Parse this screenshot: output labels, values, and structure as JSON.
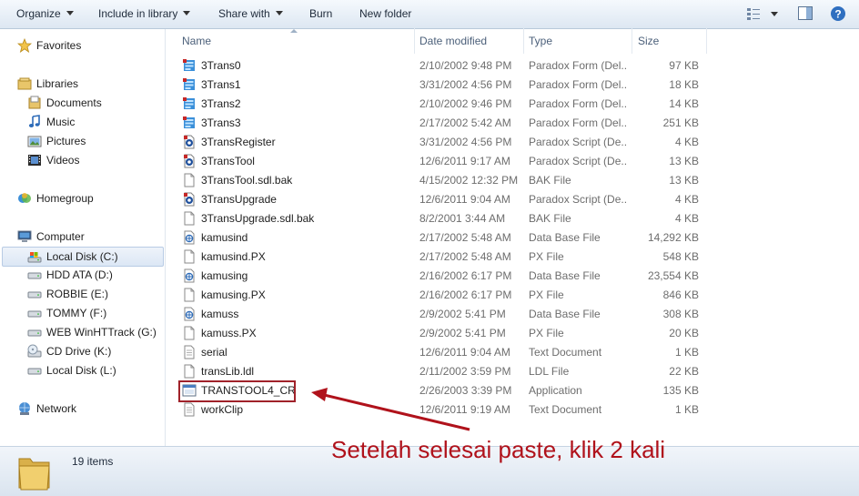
{
  "toolbar": {
    "organize": "Organize",
    "include_in_library": "Include in library",
    "share_with": "Share with",
    "burn": "Burn",
    "new_folder": "New folder"
  },
  "nav": {
    "favorites": "Favorites",
    "libraries": "Libraries",
    "documents": "Documents",
    "music": "Music",
    "pictures": "Pictures",
    "videos": "Videos",
    "homegroup": "Homegroup",
    "computer": "Computer",
    "drives": [
      "Local Disk (C:)",
      "HDD ATA (D:)",
      "ROBBIE (E:)",
      "TOMMY (F:)",
      "WEB WinHTTrack (G:)",
      "CD Drive (K:)",
      "Local Disk (L:)"
    ],
    "network": "Network"
  },
  "columns": {
    "name": "Name",
    "date": "Date modified",
    "type": "Type",
    "size": "Size"
  },
  "files": [
    {
      "name": "3Trans0",
      "date": "2/10/2002 9:48 PM",
      "type": "Paradox Form (Del...",
      "size": "97 KB",
      "icon": "form"
    },
    {
      "name": "3Trans1",
      "date": "3/31/2002 4:56 PM",
      "type": "Paradox Form (Del...",
      "size": "18 KB",
      "icon": "form"
    },
    {
      "name": "3Trans2",
      "date": "2/10/2002 9:46 PM",
      "type": "Paradox Form (Del...",
      "size": "14 KB",
      "icon": "form"
    },
    {
      "name": "3Trans3",
      "date": "2/17/2002 5:42 AM",
      "type": "Paradox Form (Del...",
      "size": "251 KB",
      "icon": "form"
    },
    {
      "name": "3TransRegister",
      "date": "3/31/2002 4:56 PM",
      "type": "Paradox Script (De...",
      "size": "4 KB",
      "icon": "script"
    },
    {
      "name": "3TransTool",
      "date": "12/6/2011 9:17 AM",
      "type": "Paradox Script (De...",
      "size": "13 KB",
      "icon": "script"
    },
    {
      "name": "3TransTool.sdl.bak",
      "date": "4/15/2002 12:32 PM",
      "type": "BAK File",
      "size": "13 KB",
      "icon": "blank"
    },
    {
      "name": "3TransUpgrade",
      "date": "12/6/2011 9:04 AM",
      "type": "Paradox Script (De...",
      "size": "4 KB",
      "icon": "script"
    },
    {
      "name": "3TransUpgrade.sdl.bak",
      "date": "8/2/2001 3:44 AM",
      "type": "BAK File",
      "size": "4 KB",
      "icon": "blank"
    },
    {
      "name": "kamusind",
      "date": "2/17/2002 5:48 AM",
      "type": "Data Base File",
      "size": "14,292 KB",
      "icon": "db"
    },
    {
      "name": "kamusind.PX",
      "date": "2/17/2002 5:48 AM",
      "type": "PX File",
      "size": "548 KB",
      "icon": "blank"
    },
    {
      "name": "kamusing",
      "date": "2/16/2002 6:17 PM",
      "type": "Data Base File",
      "size": "23,554 KB",
      "icon": "db"
    },
    {
      "name": "kamusing.PX",
      "date": "2/16/2002 6:17 PM",
      "type": "PX File",
      "size": "846 KB",
      "icon": "blank"
    },
    {
      "name": "kamuss",
      "date": "2/9/2002 5:41 PM",
      "type": "Data Base File",
      "size": "308 KB",
      "icon": "db"
    },
    {
      "name": "kamuss.PX",
      "date": "2/9/2002 5:41 PM",
      "type": "PX File",
      "size": "20 KB",
      "icon": "blank"
    },
    {
      "name": "serial",
      "date": "12/6/2011 9:04 AM",
      "type": "Text Document",
      "size": "1 KB",
      "icon": "text"
    },
    {
      "name": "transLib.ldl",
      "date": "2/11/2002 3:59 PM",
      "type": "LDL File",
      "size": "22 KB",
      "icon": "blank"
    },
    {
      "name": "TRANSTOOL4_CR",
      "date": "2/26/2003 3:39 PM",
      "type": "Application",
      "size": "135 KB",
      "icon": "app"
    },
    {
      "name": "workClip",
      "date": "12/6/2011 9:19 AM",
      "type": "Text Document",
      "size": "1 KB",
      "icon": "text"
    }
  ],
  "status": {
    "count": "19 items"
  },
  "annotation": "Setelah selesai paste, klik 2 kali",
  "colors": {
    "annotation": "#b0121b",
    "toolbar_top": "#f5f9fd",
    "toolbar_bottom": "#dde7f2"
  }
}
